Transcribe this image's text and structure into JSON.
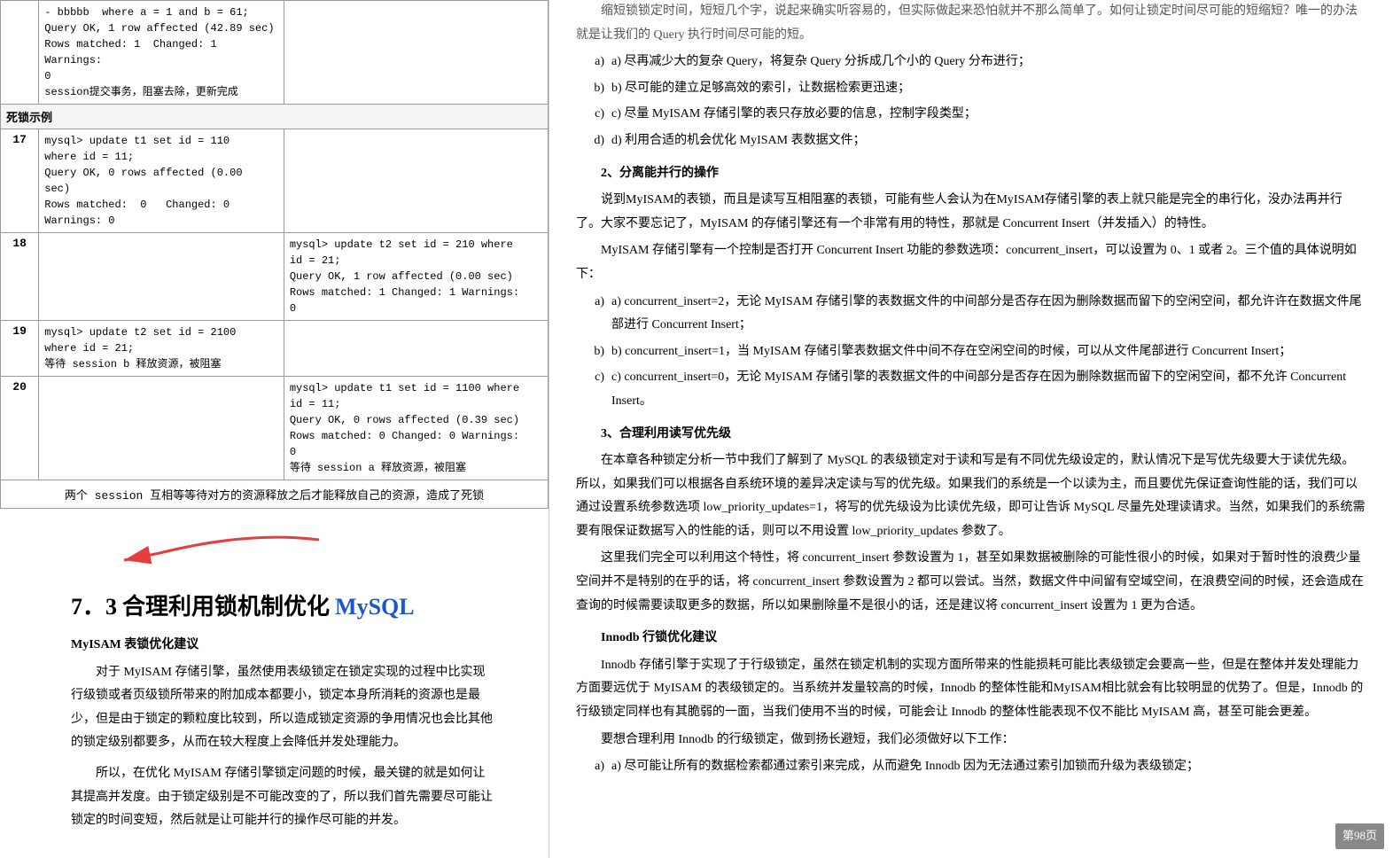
{
  "left": {
    "table": {
      "rows": [
        {
          "type": "data",
          "num": "",
          "sessionA": "- bbbbb  where a = 1 and b = 61;\nQuery OK, 1 row affected (42.89 sec)\nRows matched: 1  Changed: 1 Warnings:\n0\nsession提交事务，阻塞去除，更新完成",
          "sessionB": ""
        },
        {
          "type": "section",
          "label": "死锁示例"
        },
        {
          "type": "data",
          "num": "17",
          "sessionA": "mysql> update t1 set id = 110\nwhere id = 11;\nQuery OK, 0 rows affected (0.00\nsec)\nRows matched:  0   Changed: 0\nWarnings: 0",
          "sessionB": ""
        },
        {
          "type": "data",
          "num": "18",
          "sessionA": "",
          "sessionB": "mysql> update t2 set id = 210 where\nid = 21;\nQuery OK, 1 row affected (0.00 sec)\nRows matched: 1 Changed: 1 Warnings:\n0"
        },
        {
          "type": "data",
          "num": "19",
          "sessionA": "mysql> update t2 set id = 2100\nwhere id = 21;\n等待 session b 释放资源，被阻塞",
          "sessionB": ""
        },
        {
          "type": "data",
          "num": "20",
          "sessionA": "",
          "sessionB": "mysql> update t1 set id = 1100 where\nid = 11;\nQuery OK, 0 rows affected (0.39 sec)\nRows matched: 0 Changed: 0 Warnings:\n0\n等待 session a 释放资源，被阻塞"
        },
        {
          "type": "footer",
          "text": "两个 session 互相等等待对方的资源释放之后才能释放自己的资源，造成了死锁"
        }
      ]
    },
    "heading": {
      "num": "7．3",
      "title": "合理利用锁机制优化",
      "highlight": "MySQL"
    },
    "content": {
      "section1_title": "MyISAM 表锁优化建议",
      "section1_para1": "对于 MyISAM 存储引擎，虽然使用表级锁定在锁定实现的过程中比实现行级锁或者页级锁所带来的附加成本都要小，锁定本身所消耗的资源也是最少，但是由于锁定的颗粒度比较到，所以造成锁定资源的争用情况也会比其他的锁定级别都要多，从而在较大程度上会降低并发处理能力。",
      "section1_para2": "所以，在优化 MyISAM 存储引擎锁定问题的时候，最关键的就是如何让其提高并发度。由于锁定级别是不可能改变的了，所以我们首先需要尽可能让锁定的时间变短，然后就是让可能并行的操作尽可能的并发。"
    }
  },
  "right": {
    "top_fade": "缩短锁锁定时间，短短几个字，说起来确实听容易的，但实际做起来恐怕就并不那么简单了。如何让锁定时间尽可能的短缩短？唯一的办法就是让我们的 Query 执行时间尽可能的短。",
    "list_a": "a)\t尽再减少大的复杂 Query，将复杂 Query 分拆成几个小的 Query 分布进行；",
    "list_b": "b)\t尽可能的建立足够高效的索引，让数据检索更迅速；",
    "list_c": "c)\t尽量 MyISAM 存储引擎的表只存放必要的信息，控制字段类型；",
    "list_d": "d)\t利用合适的机会优化 MyISAM 表数据文件；",
    "section2_title": "2、分离能并行的操作",
    "section2_intro": "说到MyISAM的表锁，而且是读写互相阻塞的表锁，可能有些人会认为在MyISAM存储引擎的表上就只能是完全的串行化，没办法再并行了。大家不要忘记了，MyISAM 的存储引擎还有一个非常有用的特性，那就是 Concurrent Insert（并发插入）的特性。",
    "section2_para": "MyISAM 存储引擎有一个控制是否打开 Concurrent Insert 功能的参数选项：concurrent_insert，可以设置为 0、1 或者 2。三个值的具体说明如下：",
    "ci_a": "a)\tconcurrent_insert=2，无论 MyISAM 存储引擎的表数据文件的中间部分是否存在因为删除数据而留下的空闲空间，都允许许在数据文件尾部进行 Concurrent Insert；",
    "ci_b": "b)\tconcurrent_insert=1，当 MyISAM 存储引擎表数据文件中间不存在空闲空间的时候，可以从文件尾部进行 Concurrent Insert；",
    "ci_c": "c)\tconcurrent_insert=0，无论 MyISAM 存储引擎的表数据文件的中间部分是否存在因为删除数据而留下的空闲空间，都不允许 Concurrent Insert。",
    "section3_title": "3、合理利用读写优先级",
    "section3_para1": "在本章各种锁定分析一节中我们了解到了 MySQL 的表级锁定对于读和写是有不同优先级设定的，默认情况下是写优先级要大于读优先级。所以，如果我们可以根据各自系统环境的差异决定读与写的优先级。如果我们的系统是一个以读为主，而且要优先保证查询性能的话，我们可以通过设置系统参数选项 low_priority_updates=1，将写的优先级设为比读优先级，即可让告诉 MySQL 尽量先处理读请求。当然，如果我们的系统需要有限保证数据写入的性能的话，则可以不用设置 low_priority_updates 参数了。",
    "section3_para2": "这里我们完全可以利用这个特性，将 concurrent_insert 参数设置为 1，甚至如果数据被删除的可能性很小的时候，如果对于暂时性的浪费少量空间并不是特别的在乎的话，将 concurrent_insert 参数设置为 2 都可以尝试。当然，数据文件中间留有空域空间，在浪费空间的时候，还会造成在查询的时候需要读取更多的数据，所以如果删除量不是很小的话，还是建议将 concurrent_insert 设置为 1 更为合适。",
    "innodb_title": "Innodb 行锁优化建议",
    "innodb_intro": "Innodb 存储引擎于实现了于行级锁定，虽然在锁定机制的实现方面所带来的性能损耗可能比表级锁定会要高一些，但是在整体并发处理能力方面要远优于 MyISAM 的表级锁定的。当系统并发量较高的时候，Innodb 的整体性能和MyISAM相比就会有比较明显的优势了。但是，Innodb 的行级锁定同样也有其脆弱的一面，当我们使用不当的时候，可能会让 Innodb 的整体性能表现不仅不能比 MyISAM 高，甚至可能会更差。",
    "innodb_advice": "要想合理利用 Innodb 的行级锁定，做到扬长避短，我们必须做好以下工作：",
    "innodb_a": "a)\t尽可能让所有的数据检索都通过索引来完成，从而避免 Innodb 因为无法通过索引加锁而升级为表级锁定；",
    "page_num": "第98页"
  }
}
